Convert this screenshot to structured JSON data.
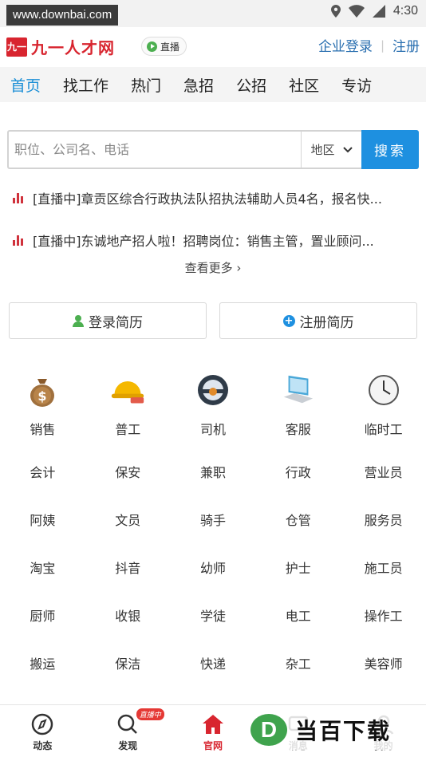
{
  "status_bar": {
    "watermark": "www.downbai.com",
    "time": "4:30"
  },
  "header": {
    "logo_mark": "九一",
    "logo_text": "九一人才网",
    "live_label": "直播",
    "employer_login": "企业登录",
    "separator": "|",
    "register": "注册"
  },
  "nav": {
    "tabs": [
      {
        "label": "首页",
        "active": true
      },
      {
        "label": "找工作"
      },
      {
        "label": "热门"
      },
      {
        "label": "急招"
      },
      {
        "label": "公招"
      },
      {
        "label": "社区"
      },
      {
        "label": "专访"
      }
    ]
  },
  "search": {
    "placeholder": "职位、公司名、电话",
    "region_label": "地区",
    "button_label": "搜索"
  },
  "live_feed": {
    "items": [
      "[直播中]章贡区综合行政执法队招执法辅助人员4名，报名快...",
      "[直播中]东诚地产招人啦！招聘岗位：销售主管，置业顾问..."
    ],
    "see_more": "查看更多 ›"
  },
  "resume": {
    "login_label": "登录简历",
    "register_label": "注册简历"
  },
  "categories": {
    "icon_row": [
      {
        "label": "销售",
        "icon": "money-bag-icon"
      },
      {
        "label": "普工",
        "icon": "hard-hat-icon"
      },
      {
        "label": "司机",
        "icon": "steering-wheel-icon"
      },
      {
        "label": "客服",
        "icon": "computer-icon"
      },
      {
        "label": "临时工",
        "icon": "clock-icon"
      }
    ],
    "rows": [
      [
        "会计",
        "保安",
        "兼职",
        "行政",
        "营业员"
      ],
      [
        "阿姨",
        "文员",
        "骑手",
        "仓管",
        "服务员"
      ],
      [
        "淘宝",
        "抖音",
        "幼师",
        "护士",
        "施工员"
      ],
      [
        "厨师",
        "收银",
        "学徒",
        "电工",
        "操作工"
      ],
      [
        "搬运",
        "保洁",
        "快递",
        "杂工",
        "美容师"
      ]
    ]
  },
  "bottom_bar": {
    "items": [
      {
        "label": "动态",
        "icon": "compass-icon"
      },
      {
        "label": "发现",
        "icon": "search-icon",
        "badge": "直播中"
      },
      {
        "label": "官网",
        "icon": "home-icon",
        "active": true
      },
      {
        "label": "消息",
        "icon": "message-icon"
      },
      {
        "label": "我的",
        "icon": "user-icon"
      }
    ]
  },
  "watermark_bottom": {
    "letter": "D",
    "text": "当百下载"
  },
  "colors": {
    "brand_red": "#d8252f",
    "accent_blue": "#1e90e0",
    "live_red": "#d0323c"
  }
}
